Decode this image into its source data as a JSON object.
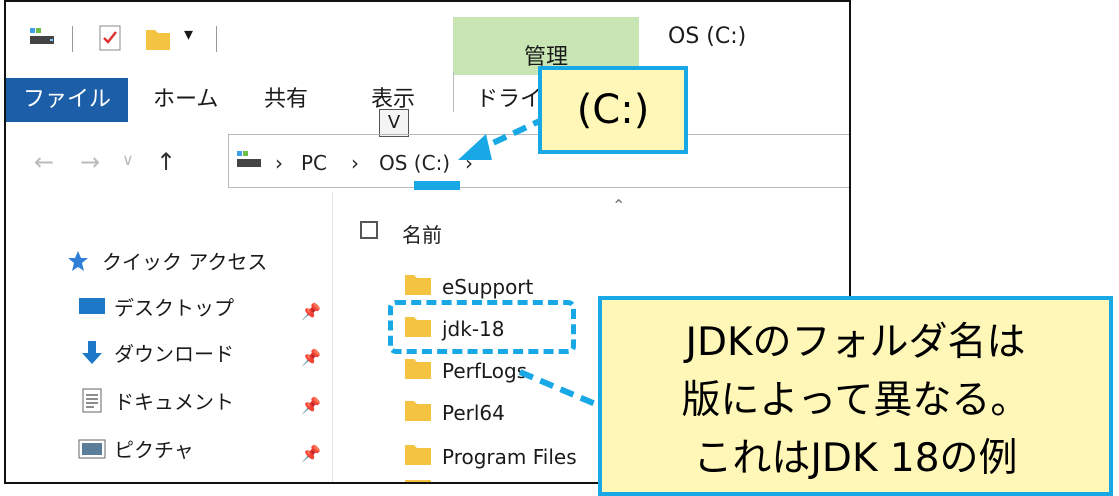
{
  "window": {
    "title": "OS (C:)",
    "context_tab": "管理",
    "tabs": [
      "ファイル",
      "ホーム",
      "共有",
      "表示",
      "ドライブ"
    ],
    "keytip": "V"
  },
  "address_bar": {
    "crumbs": [
      "PC",
      "OS (C:)"
    ]
  },
  "sidebar": {
    "items": [
      {
        "label": "クイック アクセス",
        "icon": "star-icon"
      },
      {
        "label": "デスクトップ",
        "icon": "desktop-icon",
        "pinned": true
      },
      {
        "label": "ダウンロード",
        "icon": "download-arrow-icon",
        "pinned": true
      },
      {
        "label": "ドキュメント",
        "icon": "document-icon",
        "pinned": true
      },
      {
        "label": "ピクチャ",
        "icon": "picture-icon",
        "pinned": true
      }
    ]
  },
  "file_list": {
    "column_name": "名前",
    "items": [
      "eSupport",
      "jdk-18",
      "PerfLogs",
      "Perl64",
      "Program Files"
    ]
  },
  "annotations": {
    "drive_callout": "(C:)",
    "note_lines": [
      "JDKのフォルダ名は",
      "版によって異なる。",
      "これはJDK 18の例"
    ],
    "accent_color": "#19a8e6",
    "callout_fill": "#fff7b8"
  }
}
